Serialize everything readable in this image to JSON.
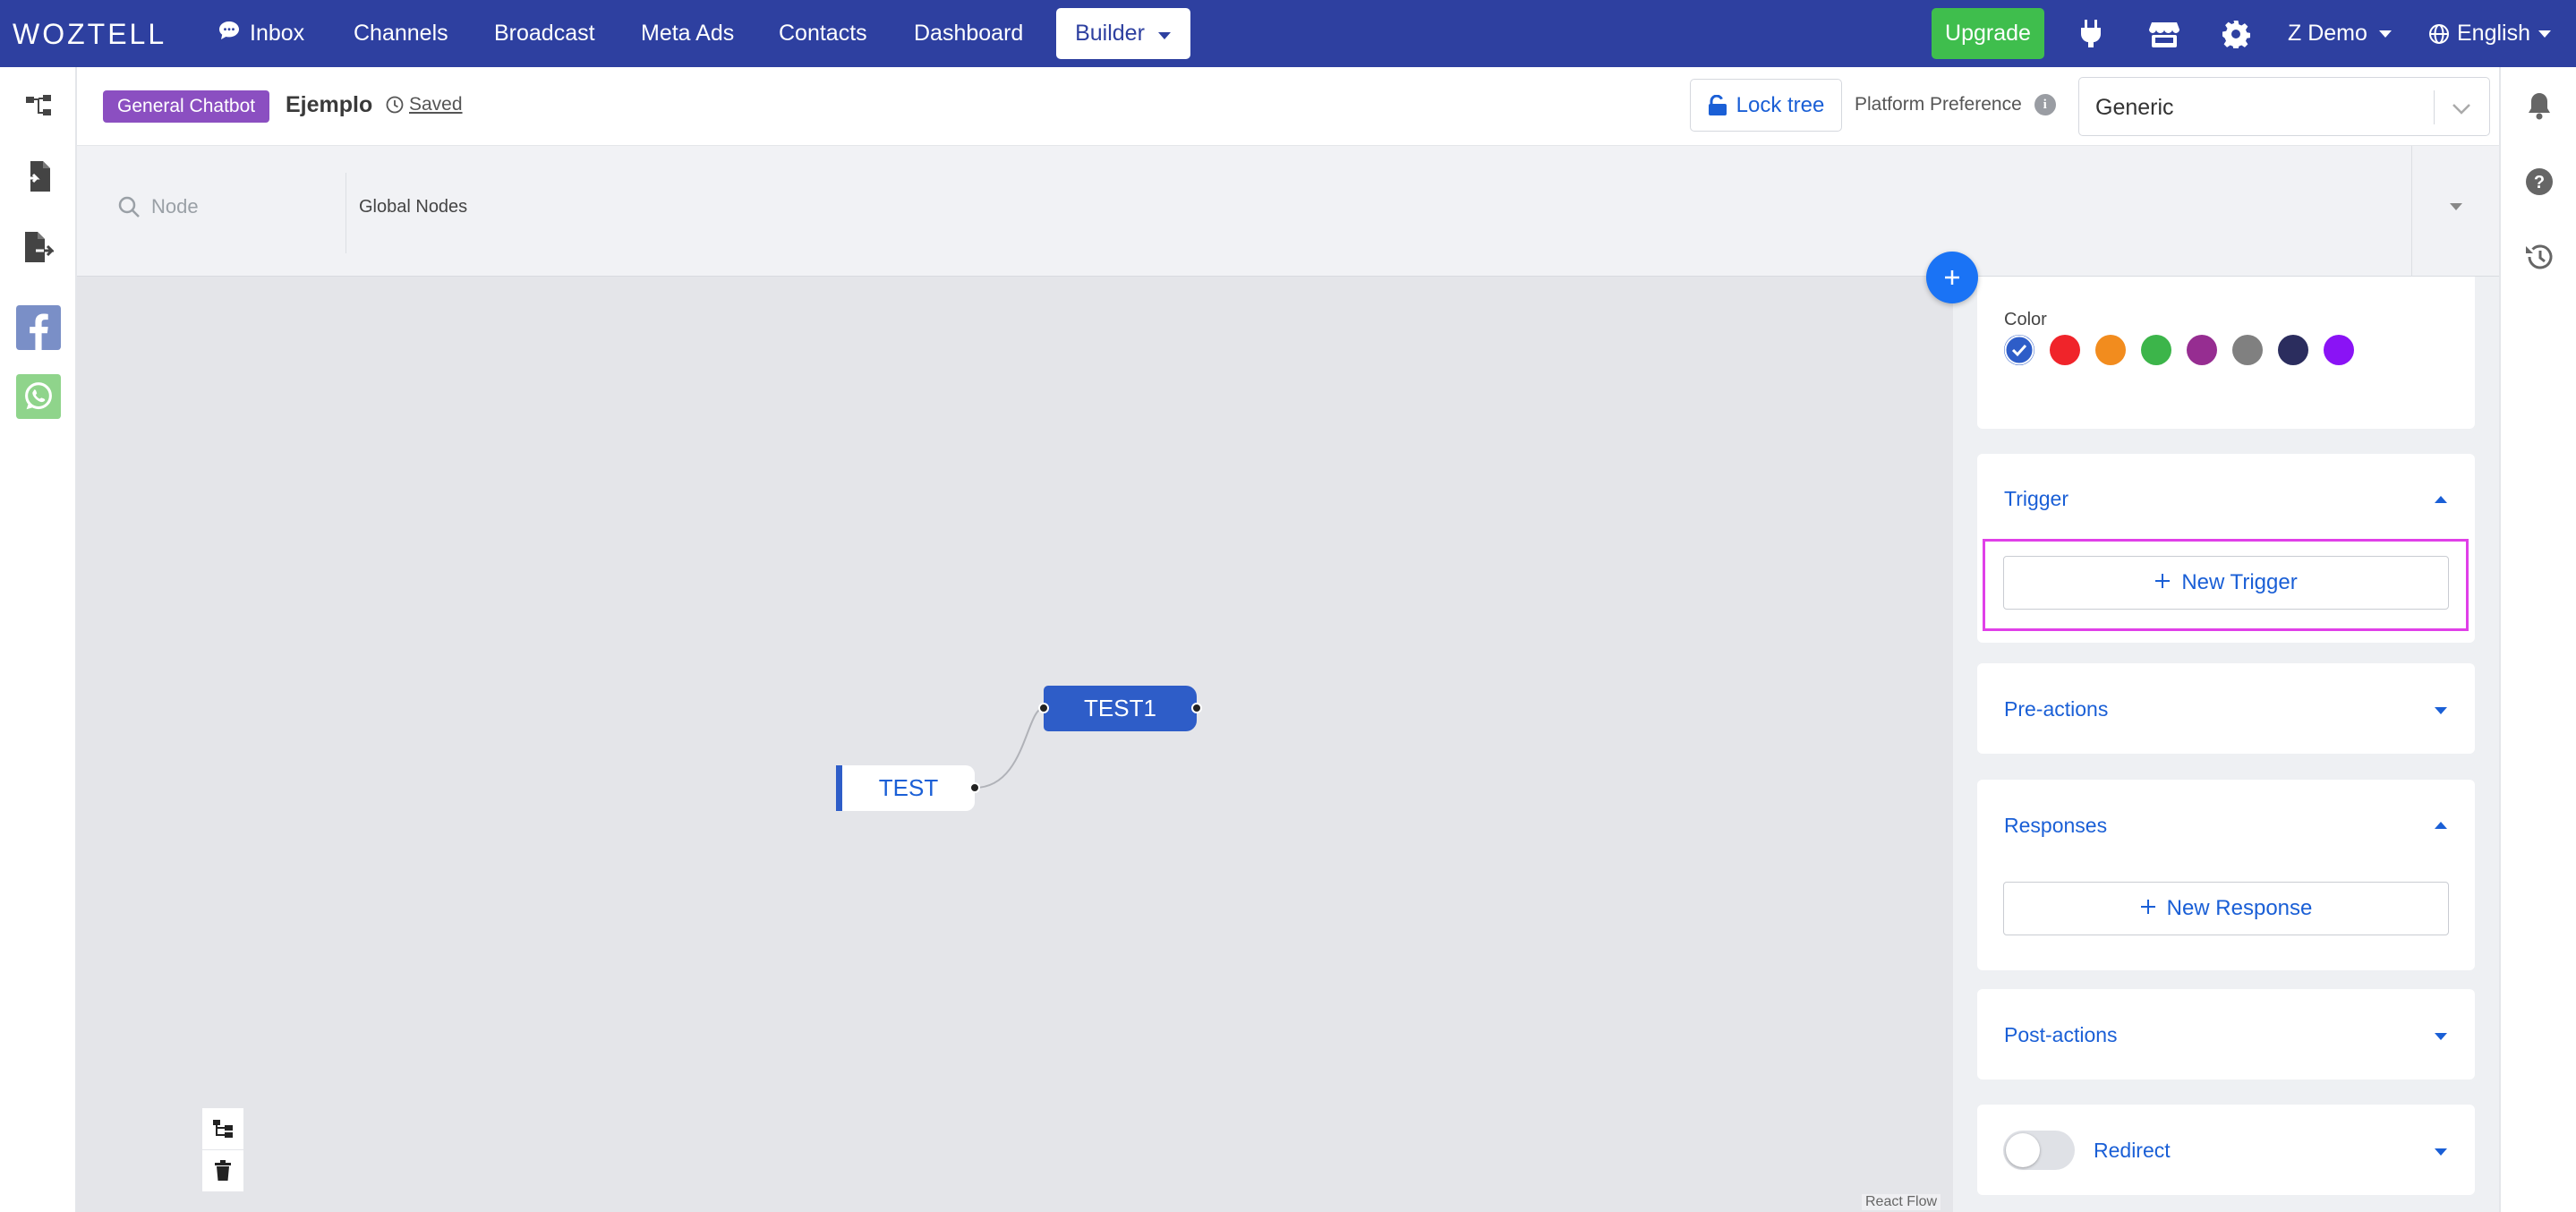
{
  "topbar": {
    "logo": "WOZTELL",
    "nav": {
      "inbox": "Inbox",
      "channels": "Channels",
      "broadcast": "Broadcast",
      "meta_ads": "Meta Ads",
      "contacts": "Contacts",
      "dashboard": "Dashboard",
      "builder": "Builder"
    },
    "upgrade": "Upgrade",
    "user": "Z Demo",
    "language": "English",
    "colors": {
      "bar": "#2e40a0",
      "upgrade": "#3fbe4d"
    }
  },
  "header": {
    "badge": "General Chatbot",
    "flow_name": "Ejemplo",
    "saved": "Saved",
    "lock_tree": "Lock tree",
    "platform_preference": "Platform Preference",
    "platform_value": "Generic"
  },
  "search": {
    "placeholder": "Node",
    "global_nodes": "Global Nodes"
  },
  "canvas": {
    "nodes": [
      {
        "label": "TEST"
      },
      {
        "label": "TEST1"
      }
    ],
    "attribution": "React Flow"
  },
  "panel": {
    "color_label": "Color",
    "colors": [
      "#2e5dc8",
      "#f0242a",
      "#f28c1e",
      "#3cb54a",
      "#962d91",
      "#808080",
      "#2b2d5e",
      "#8a13f5"
    ],
    "selected_color_index": 0,
    "trigger": {
      "title": "Trigger",
      "button": "New Trigger",
      "expanded": true
    },
    "pre_actions": {
      "title": "Pre-actions",
      "expanded": false
    },
    "responses": {
      "title": "Responses",
      "button": "New Response",
      "expanded": true
    },
    "post_actions": {
      "title": "Post-actions",
      "expanded": false
    },
    "redirect": {
      "title": "Redirect",
      "enabled": false
    }
  }
}
